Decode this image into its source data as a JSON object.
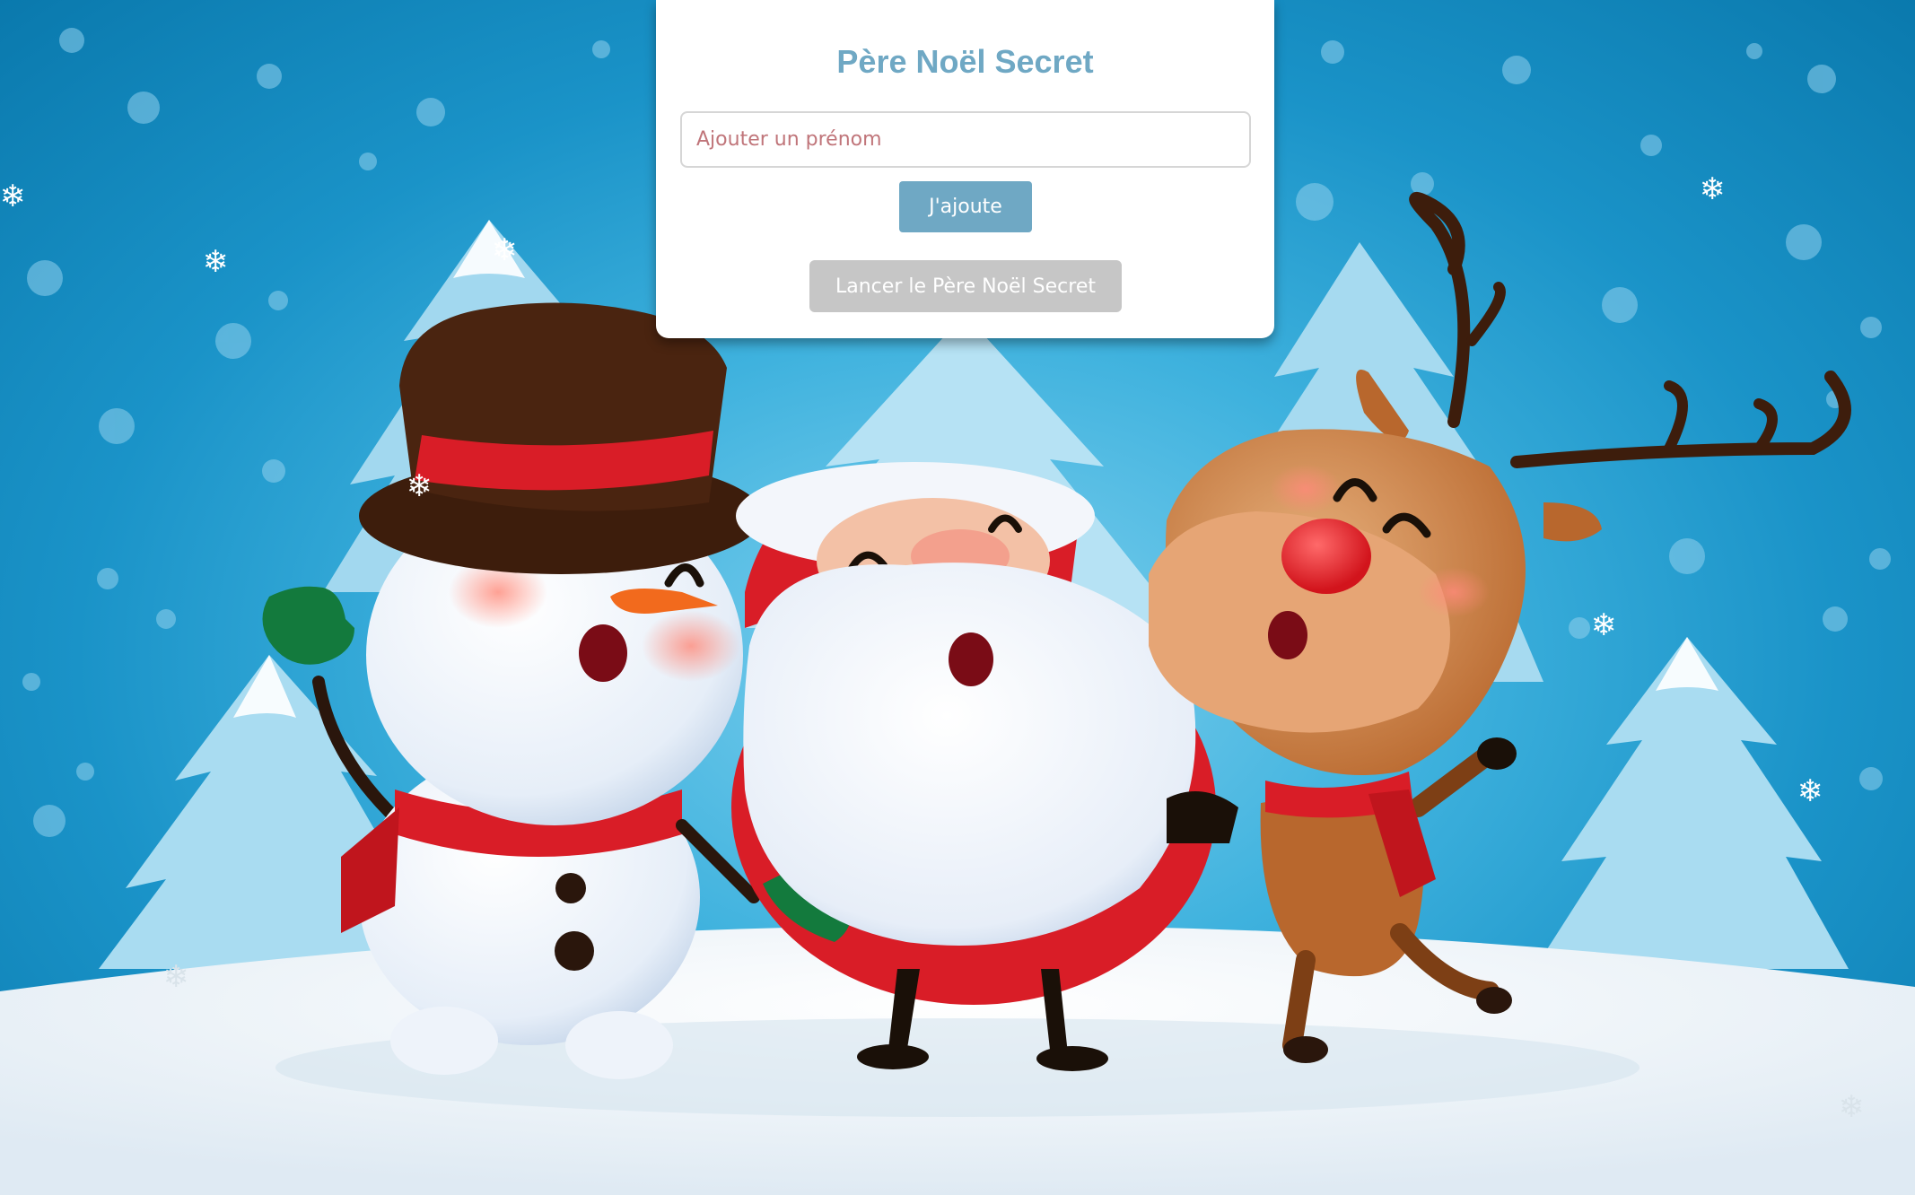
{
  "app": {
    "title": "Père Noël Secret"
  },
  "form": {
    "name_placeholder": "Ajouter un prénom",
    "name_value": "",
    "add_label": "J'ajoute",
    "launch_label": "Lancer le Père Noël Secret"
  },
  "colors": {
    "accent": "#6fa8c4",
    "disabled_button": "#c6c6c6",
    "placeholder": "#c0757a"
  },
  "background": {
    "characters": [
      "snowman",
      "santa-claus",
      "reindeer"
    ]
  }
}
